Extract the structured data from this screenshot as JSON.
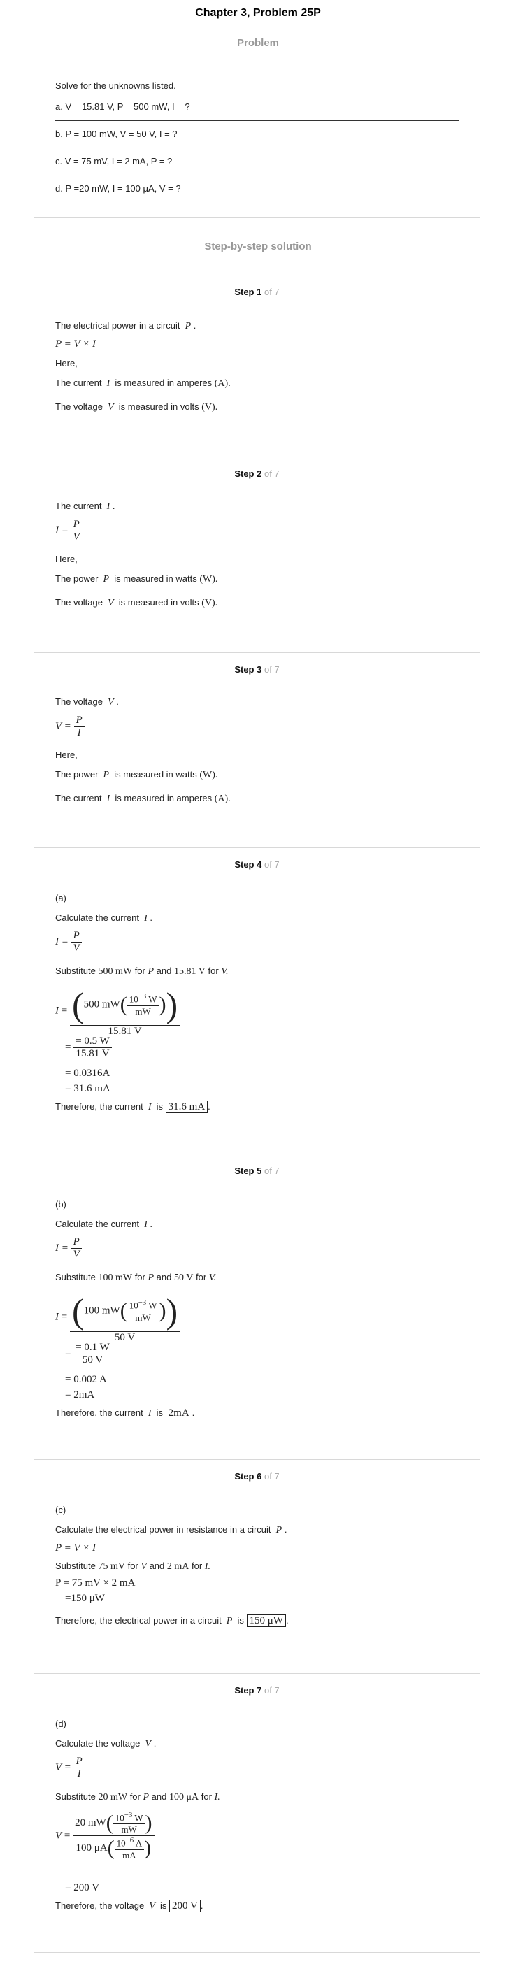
{
  "header": {
    "title": "Chapter 3, Problem 25P"
  },
  "problem": {
    "heading": "Problem",
    "intro": "Solve for the unknowns listed.",
    "items": [
      "a. V = 15.81 V, P = 500 mW, I = ?",
      "b. P = 100 mW, V = 50 V, I = ?",
      "c. V = 75 mV, I = 2 mA, P = ?",
      "d. P =20 mW, I = 100 μA, V = ?"
    ]
  },
  "solution": {
    "heading": "Step-by-step solution",
    "of_total": "of 7"
  },
  "steps": [
    {
      "label": "Step 1",
      "of": "of 7",
      "lines": [
        "The electrical power in a circuit",
        "P = V × I",
        "Here,",
        "The current",
        "is measured in amperes",
        "(A).",
        "The voltage",
        "is measured in volts",
        "(V)."
      ]
    },
    {
      "label": "Step 2",
      "of": "of 7",
      "lines": [
        "The current",
        "I =",
        "Here,",
        "The power",
        "is measured in watts",
        "(W).",
        "The voltage",
        "is measured in volts",
        "(V)."
      ]
    },
    {
      "label": "Step 3",
      "of": "of 7",
      "lines": [
        "The voltage",
        "V =",
        "Here,",
        "The power",
        "is measured in watts",
        "(W).",
        "The current",
        "is measured in amperes",
        "(A)."
      ]
    },
    {
      "label": "Step 4",
      "of": "of 7",
      "part": "(a)",
      "calc": "Calculate the current",
      "subst": [
        "Substitute",
        "500 mW",
        "for",
        "P",
        "and",
        "15.81 V",
        "for",
        "V."
      ],
      "work": [
        "= 0.5 W",
        "15.81 V",
        "= 0.0316A",
        "= 31.6 mA"
      ],
      "therefore": "Therefore, the current",
      "is": "is",
      "answer": "31.6 mA"
    },
    {
      "label": "Step 5",
      "of": "of 7",
      "part": "(b)",
      "calc": "Calculate the current",
      "subst": [
        "Substitute",
        "100 mW",
        "for",
        "P",
        "and",
        "50 V",
        "for",
        "V."
      ],
      "work": [
        "= 0.1 W",
        "50 V",
        "= 0.002 A",
        "= 2mA"
      ],
      "therefore": "Therefore, the current",
      "is": "is",
      "answer": "2mA"
    },
    {
      "label": "Step 6",
      "of": "of 7",
      "part": "(c)",
      "calc": "Calculate the electrical power in resistance in a circuit",
      "subst": [
        "Substitute",
        "75 mV",
        "for",
        "V",
        "and",
        "2 mA",
        "for",
        "I."
      ],
      "work": [
        "P = 75 mV × 2 mA",
        "=150 μW"
      ],
      "therefore": "Therefore, the electrical power in a circuit",
      "is": "is",
      "answer": "150 μW"
    },
    {
      "label": "Step 7",
      "of": "of 7",
      "part": "(d)",
      "calc": "Calculate the voltage",
      "subst": [
        "Substitute",
        "20 mW",
        "for",
        "P",
        "and",
        "100 μA",
        "for",
        "I."
      ],
      "work": [
        "= 200 V"
      ],
      "therefore": "Therefore, the voltage",
      "is": "is",
      "answer": "200 V"
    }
  ]
}
